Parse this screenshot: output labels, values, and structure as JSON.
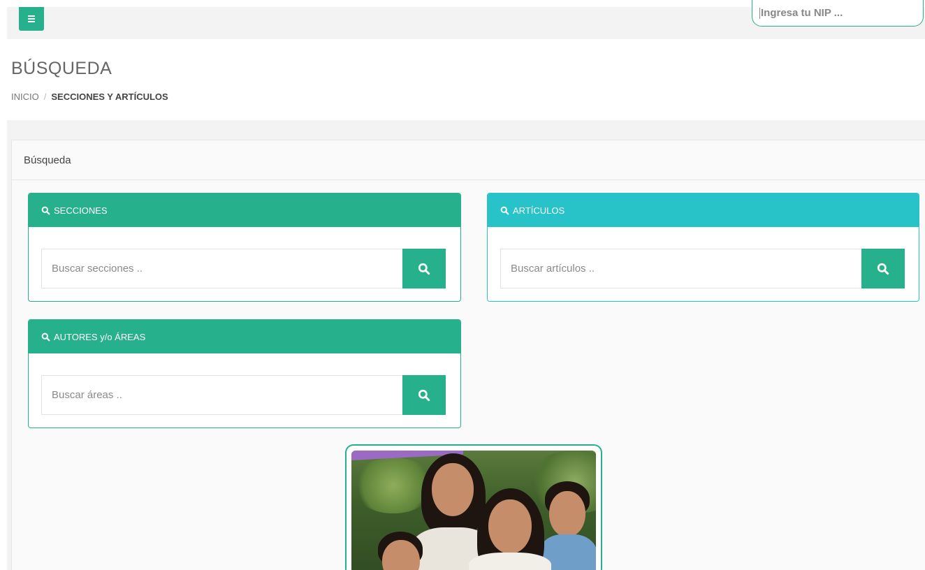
{
  "topbar": {
    "menu_icon": "hamburger-icon",
    "nip_placeholder": "Ingresa tu NIP ..."
  },
  "page": {
    "title": "BÚSQUEDA",
    "breadcrumb": {
      "home": "INICIO",
      "separator": "/",
      "current": "SECCIONES Y ARTÍCULOS"
    }
  },
  "panel": {
    "title": "Búsqueda",
    "boxes": [
      {
        "heading": "SECCIONES",
        "placeholder": "Buscar secciones ..",
        "icon": "search-icon",
        "color": "#26b08c"
      },
      {
        "heading": "ARTÍCULOS",
        "placeholder": "Buscar artículos ..",
        "icon": "search-icon",
        "color": "#27c3c9"
      },
      {
        "heading": "AUTORES y/o ÁREAS",
        "placeholder": "Buscar áreas ..",
        "icon": "search-icon",
        "color": "#26b08c"
      }
    ]
  },
  "promo": {
    "image": "family-photo"
  },
  "colors": {
    "accent": "#26b08c",
    "accent_cyan": "#27c3c9",
    "background": "#f3f3f3"
  }
}
